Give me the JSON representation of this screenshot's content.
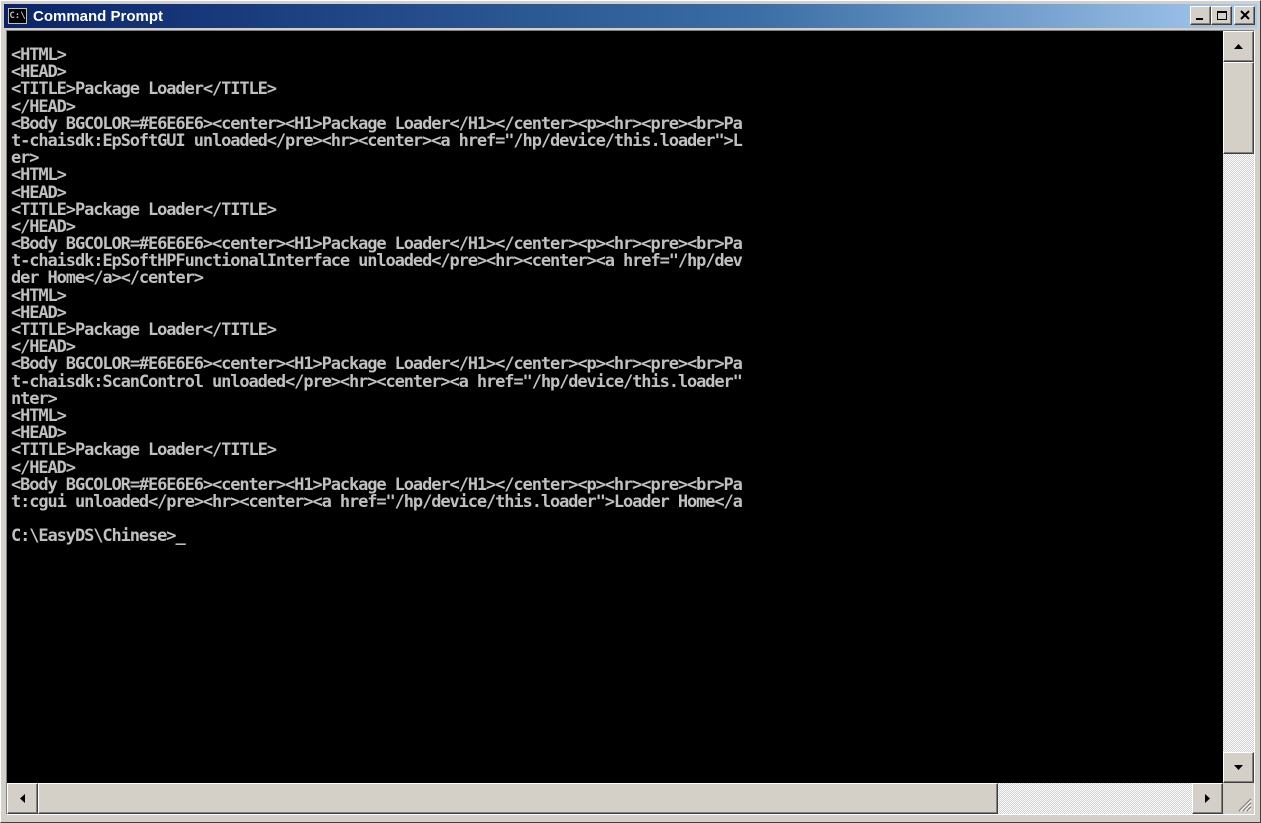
{
  "window": {
    "title": "Command Prompt",
    "app_icon_text": "C:\\"
  },
  "caption_buttons": {
    "minimize": "minimize-icon",
    "maximize": "maximize-icon",
    "close": "close-icon"
  },
  "console": {
    "lines": [
      "<HTML>",
      "<HEAD>",
      "<TITLE>Package Loader</TITLE>",
      "</HEAD>",
      "<Body BGCOLOR=#E6E6E6><center><H1>Package Loader</H1></center><p><hr><pre><br>Pa",
      "t-chaisdk:EpSoftGUI unloaded</pre><hr><center><a href=\"/hp/device/this.loader\">L",
      "er>",
      "<HTML>",
      "<HEAD>",
      "<TITLE>Package Loader</TITLE>",
      "</HEAD>",
      "<Body BGCOLOR=#E6E6E6><center><H1>Package Loader</H1></center><p><hr><pre><br>Pa",
      "t-chaisdk:EpSoftHPFunctionalInterface unloaded</pre><hr><center><a href=\"/hp/dev",
      "der Home</a></center>",
      "<HTML>",
      "<HEAD>",
      "<TITLE>Package Loader</TITLE>",
      "</HEAD>",
      "<Body BGCOLOR=#E6E6E6><center><H1>Package Loader</H1></center><p><hr><pre><br>Pa",
      "t-chaisdk:ScanControl unloaded</pre><hr><center><a href=\"/hp/device/this.loader\"",
      "nter>",
      "<HTML>",
      "<HEAD>",
      "<TITLE>Package Loader</TITLE>",
      "</HEAD>",
      "<Body BGCOLOR=#E6E6E6><center><H1>Package Loader</H1></center><p><hr><pre><br>Pa",
      "t:cgui unloaded</pre><hr><center><a href=\"/hp/device/this.loader\">Loader Home</a",
      ""
    ],
    "prompt": "C:\\EasyDS\\Chinese>",
    "cursor": "_",
    "text_color": "#c0c0c0",
    "background_color": "#000000"
  },
  "scrollbars": {
    "up_arrow": "up-arrow-icon",
    "down_arrow": "down-arrow-icon",
    "left_arrow": "left-arrow-icon",
    "right_arrow": "right-arrow-icon"
  },
  "colors": {
    "titlebar_start": "#0a246a",
    "titlebar_end": "#a6caf0",
    "chrome": "#d4d0c8"
  }
}
